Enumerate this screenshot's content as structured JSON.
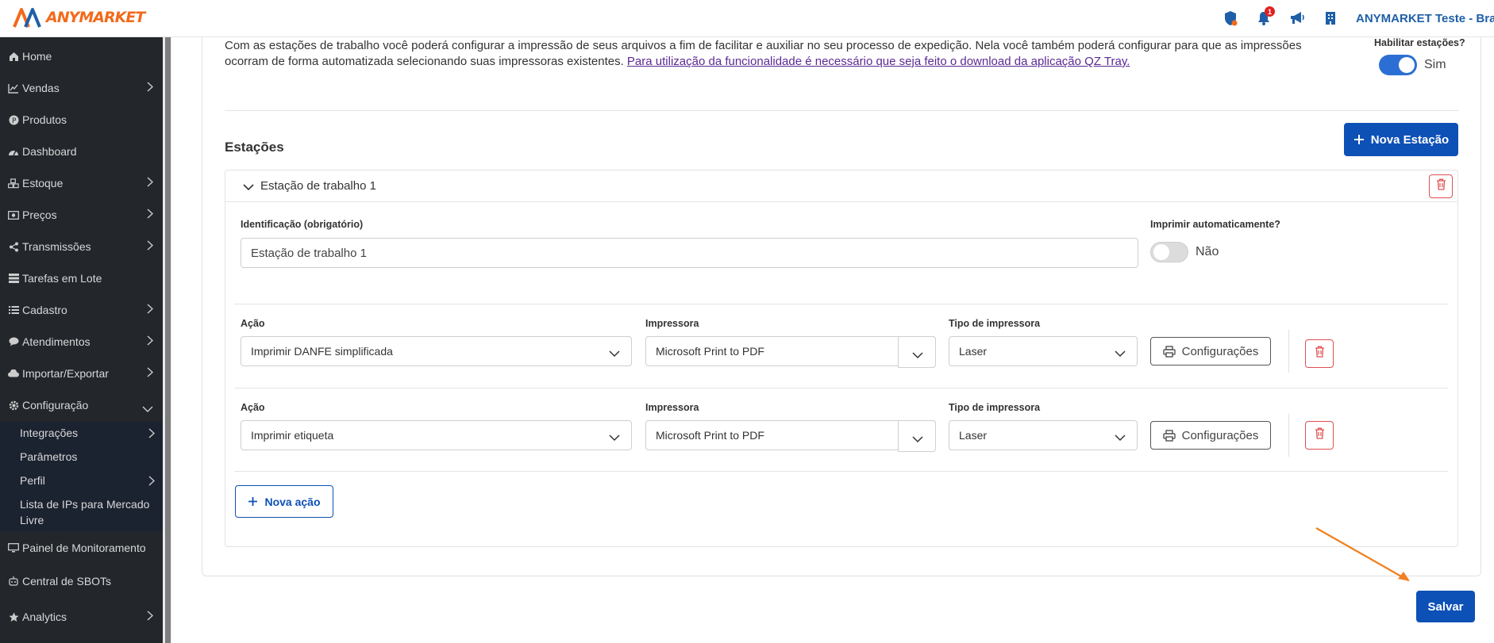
{
  "header": {
    "logo_text": "ANYMARKET",
    "notification_count": "1",
    "account_name": "ANYMARKET Teste - Brasil"
  },
  "sidebar": {
    "items": [
      {
        "label": "Home"
      },
      {
        "label": "Vendas"
      },
      {
        "label": "Produtos"
      },
      {
        "label": "Dashboard"
      },
      {
        "label": "Estoque"
      },
      {
        "label": "Preços"
      },
      {
        "label": "Transmissões"
      },
      {
        "label": "Tarefas em Lote"
      },
      {
        "label": "Cadastro"
      },
      {
        "label": "Atendimentos"
      },
      {
        "label": "Importar/Exportar"
      },
      {
        "label": "Configuração"
      }
    ],
    "sub_items": [
      {
        "label": "Integrações"
      },
      {
        "label": "Parâmetros"
      },
      {
        "label": "Perfil"
      },
      {
        "label": "Lista de IPs para Mercado Livre"
      }
    ],
    "bottom_items": [
      {
        "label": "Painel de Monitoramento"
      },
      {
        "label": "Central de SBOTs"
      },
      {
        "label": "Analytics"
      }
    ]
  },
  "intro": {
    "text": "Com as estações de trabalho você poderá configurar a impressão de seus arquivos a fim de facilitar e auxiliar no seu processo de expedição. Nela você também poderá configurar para que as impressões ocorram de forma automatizada selecionando suas impressoras existentes. ",
    "link_text": "Para utilização da funcionalidade é necessário que seja feito o download da aplicação QZ Tray."
  },
  "enable_stations": {
    "label": "Habilitar estações?",
    "value_text": "Sim"
  },
  "stations_section": {
    "title": "Estações",
    "new_station_label": "Nova Estação"
  },
  "station": {
    "title": "Estação de trabalho 1",
    "id_label": "Identificação (obrigatório)",
    "id_value": "Estação de trabalho 1",
    "auto_print_label": "Imprimir automaticamente?",
    "auto_print_value": "Não",
    "actions": [
      {
        "action_label": "Ação",
        "action_value": "Imprimir DANFE simplificada",
        "printer_label": "Impressora",
        "printer_value": "Microsoft Print to PDF",
        "type_label": "Tipo de impressora",
        "type_value": "Laser",
        "config_label": "Configurações"
      },
      {
        "action_label": "Ação",
        "action_value": "Imprimir etiqueta",
        "printer_label": "Impressora",
        "printer_value": "Microsoft Print to PDF",
        "type_label": "Tipo de impressora",
        "type_value": "Laser",
        "config_label": "Configurações"
      }
    ],
    "new_action_label": "Nova ação"
  },
  "save_label": "Salvar",
  "colors": {
    "primary": "#0d50b6",
    "sidebar_bg": "#23262b",
    "accent_orange": "#f26a1b",
    "danger": "#e05050"
  }
}
